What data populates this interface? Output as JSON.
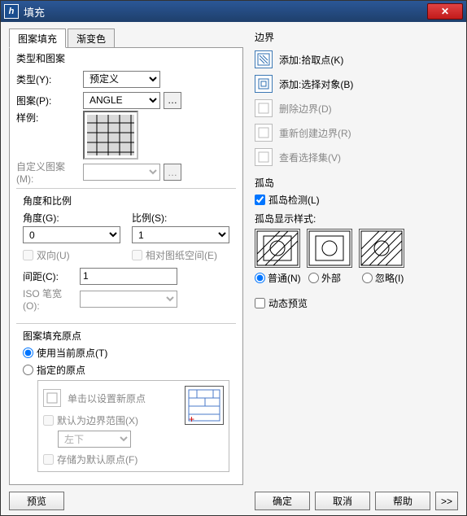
{
  "window": {
    "title": "填充"
  },
  "tabs": {
    "hatch": "图案填充",
    "gradient": "渐变色"
  },
  "typePattern": {
    "legend": "类型和图案",
    "type_lbl": "类型(Y):",
    "type_val": "预定义",
    "pattern_lbl": "图案(P):",
    "pattern_val": "ANGLE",
    "swatch_lbl": "样例:",
    "custom_lbl": "自定义图案(M):"
  },
  "angleScale": {
    "legend": "角度和比例",
    "angle_lbl": "角度(G):",
    "angle_val": "0",
    "scale_lbl": "比例(S):",
    "scale_val": "1",
    "double_lbl": "双向(U)",
    "paper_lbl": "相对图纸空间(E)",
    "spacing_lbl": "间距(C):",
    "spacing_val": "1",
    "iso_lbl": "ISO 笔宽(O):"
  },
  "origin": {
    "legend": "图案填充原点",
    "use_current": "使用当前原点(T)",
    "specified": "指定的原点",
    "click_new": "单击以设置新原点",
    "default_ext": "默认为边界范围(X)",
    "pos_val": "左下",
    "store_default": "存储为默认原点(F)"
  },
  "boundary": {
    "legend": "边界",
    "add_pick": "添加:拾取点(K)",
    "add_select": "添加:选择对象(B)",
    "remove": "删除边界(D)",
    "recreate": "重新创建边界(R)",
    "view_sel": "查看选择集(V)"
  },
  "islands": {
    "legend": "孤岛",
    "detect": "孤岛检测(L)",
    "style_lbl": "孤岛显示样式:",
    "normal": "普通(N)",
    "outer": "外部",
    "ignore": "忽略(I)"
  },
  "dyn_preview": "动态预览",
  "buttons": {
    "preview": "预览",
    "ok": "确定",
    "cancel": "取消",
    "help": "帮助",
    "expand": ">>"
  }
}
